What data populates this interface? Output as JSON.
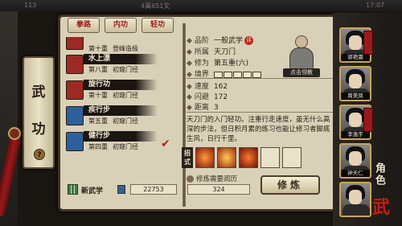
{
  "topbar": {
    "left_num": "113",
    "center": "4萬651文",
    "time": "17:07"
  },
  "scroll": {
    "title_top": "武",
    "title_bottom": "功",
    "help": "?"
  },
  "tabs": [
    {
      "label": "拳路"
    },
    {
      "label": "内功"
    },
    {
      "label": "轻功"
    }
  ],
  "skills": [
    {
      "name": "",
      "level": "第十重",
      "stage": "登峰造极",
      "book_color": "#9b2a22"
    },
    {
      "name": "水上漂",
      "level": "第八重",
      "stage": "初窥门径",
      "book_color": "#9b2a22"
    },
    {
      "name": "旋行功",
      "level": "第十重",
      "stage": "初窥门径",
      "book_color": "#9b2a22"
    },
    {
      "name": "疾行步",
      "level": "第五重",
      "stage": "初窥门径",
      "book_color": "#2f5f9a"
    },
    {
      "name": "健行步",
      "level": "第四重",
      "stage": "初窥门径",
      "book_color": "#2f5f9a"
    }
  ],
  "footer_left": {
    "label": "新武学",
    "value": "22753"
  },
  "detail": {
    "grade_label": "品阶",
    "grade_value": "一般武学",
    "grade_badge": "评",
    "sect_label": "所属",
    "sect_value": "天刀门",
    "cultivation_label": "修为",
    "cultivation_value": "第五重(六)",
    "realm_label": "境界",
    "speed_label": "速度",
    "speed_value": "162",
    "dodge_label": "闪避",
    "dodge_value": "172",
    "range_label": "距离",
    "range_value": "3",
    "master_caption": "点击领教",
    "description": "天刀门的入门轻功。注重行走速度，虽无什么高深的步法，但日积月累的练习也能让修习者脚底生风，日行千里。",
    "moves_label": "招式",
    "need_label": "修炼需要阅历",
    "need_value": "324",
    "train_button": "修炼"
  },
  "characters": [
    {
      "name": "郭艳霜"
    },
    {
      "name": "周美凤"
    },
    {
      "name": "李逸宇"
    },
    {
      "name": "钟天仁"
    },
    {
      "name": ""
    }
  ],
  "role_label": "角色",
  "seal": "武"
}
